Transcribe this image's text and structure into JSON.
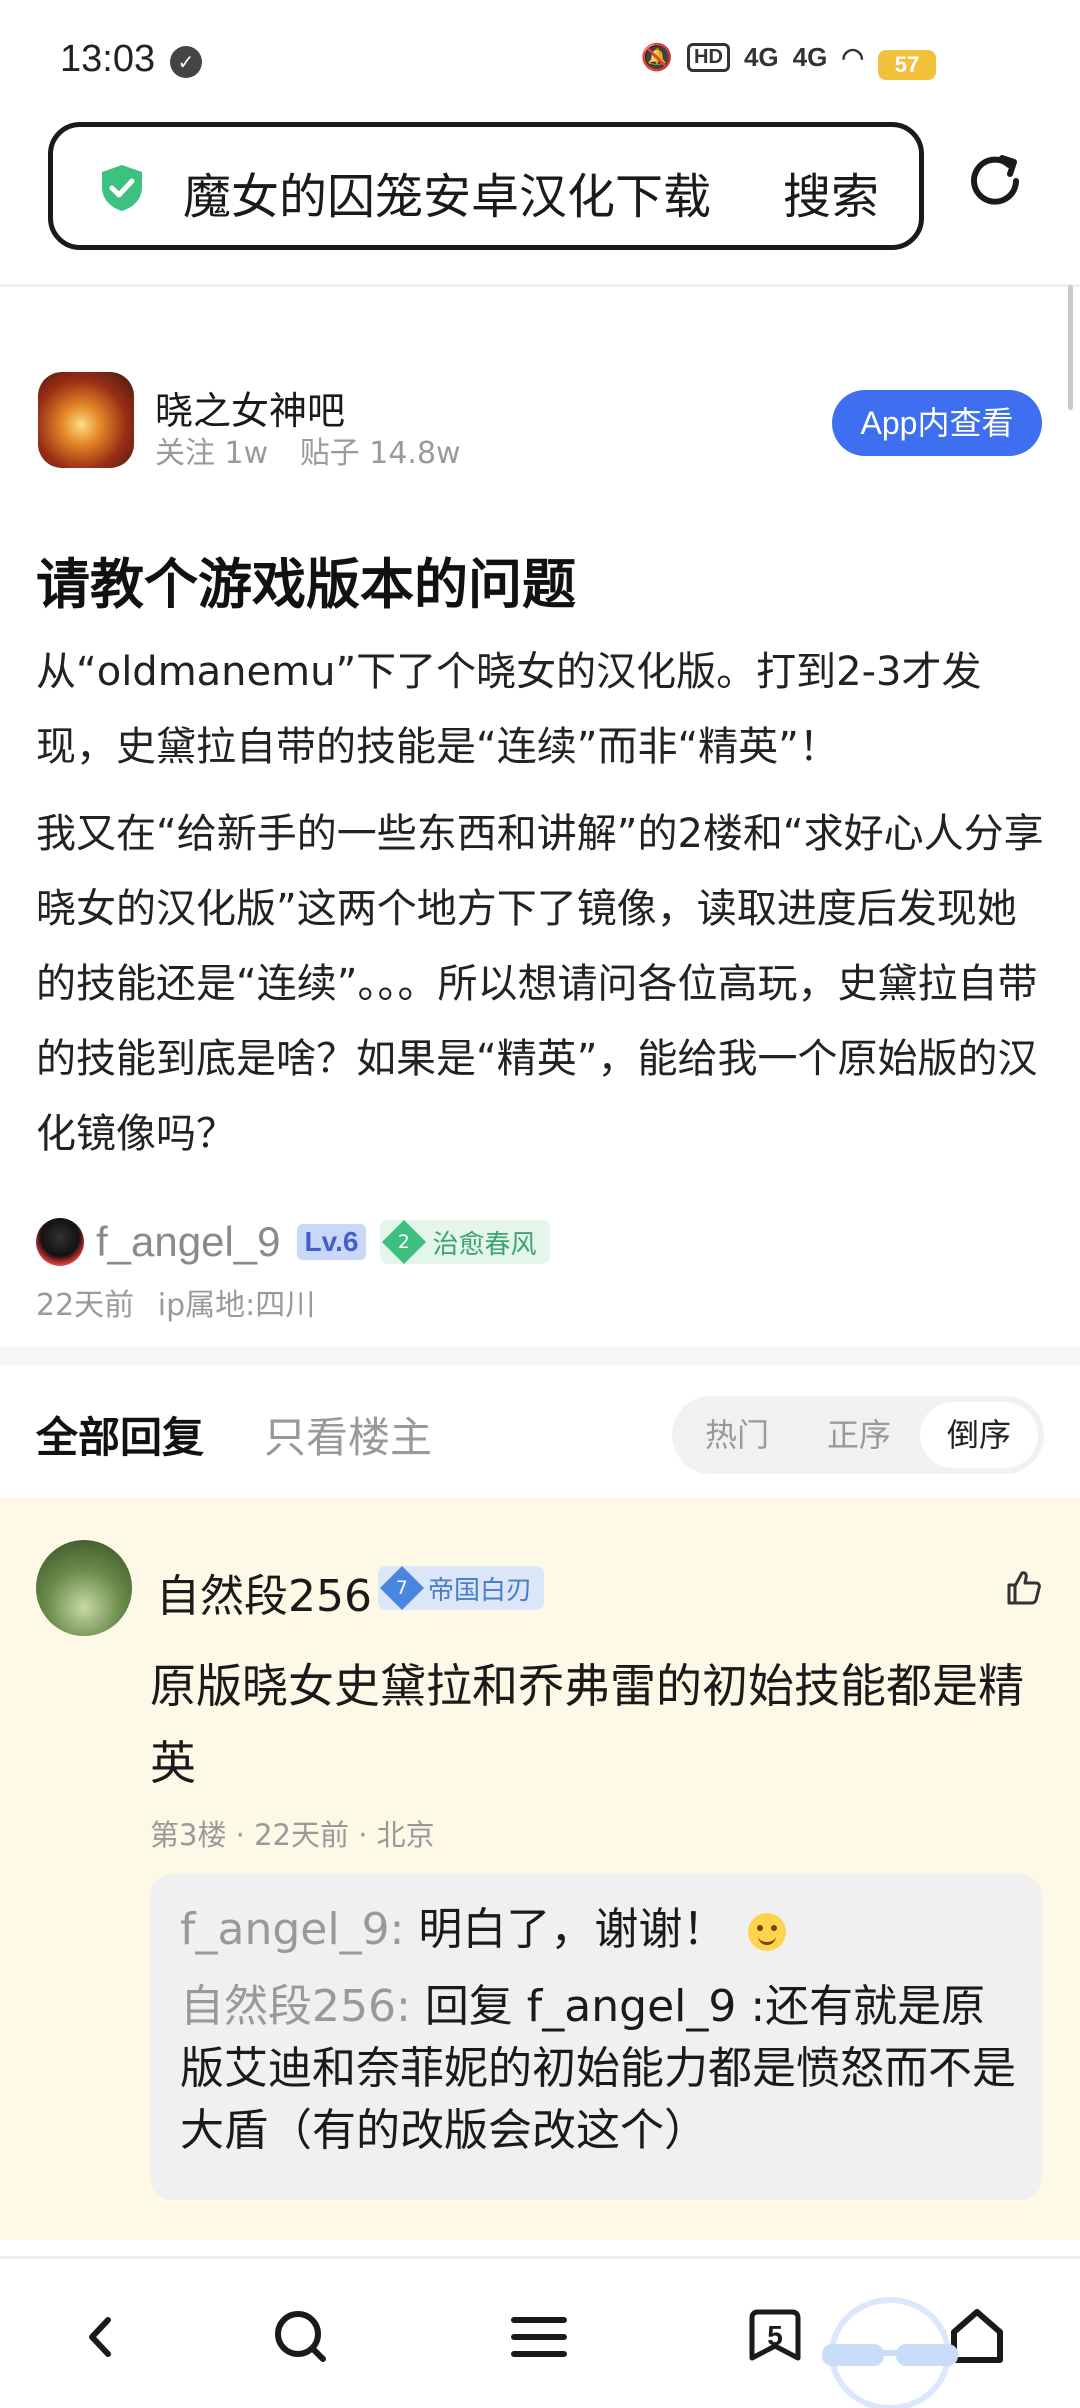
{
  "status_bar": {
    "time": "13:03",
    "hd": "HD",
    "signal1": "4G",
    "signal2": "4G",
    "battery": "57"
  },
  "search": {
    "query": "魔女的囚笼安卓汉化下载",
    "button": "搜索"
  },
  "forum": {
    "name": "晓之女神吧",
    "followers": "关注 1w",
    "posts": "贴子 14.8w",
    "app_button": "App内查看"
  },
  "post": {
    "title": "请教个游戏版本的问题",
    "paragraph1": "从“oldmanemu”下了个晓女的汉化版。打到2-3才发现，史黛拉自带的技能是“连续”而非“精英”！",
    "paragraph2": "我又在“给新手的一些东西和讲解”的2楼和“求好心人分享晓女的汉化版”这两个地方下了镜像，读取进度后发现她的技能还是“连续”。。。所以想请问各位高玩，史黛拉自带的技能到底是啥？如果是“精英”，能给我一个原始版的汉化镜像吗？",
    "author": "f_angel_9",
    "level": "Lv.6",
    "honor_level": "2",
    "honor_title": "治愈春风",
    "time": "22天前",
    "ip": "ip属地:四川"
  },
  "reply_header": {
    "tab_all": "全部回复",
    "tab_op": "只看楼主",
    "sort_hot": "热门",
    "sort_asc": "正序",
    "sort_desc": "倒序"
  },
  "reply": {
    "author": "自然段256",
    "honor_level": "7",
    "honor_title": "帝国白刃",
    "content": "原版晓女史黛拉和乔弗雷的初始技能都是精英",
    "meta": "第3楼 · 22天前 · 北京",
    "sub_replies": [
      {
        "user": "f_angel_9:",
        "text": "明白了，谢谢！",
        "emoji": "smile-emoji-icon"
      },
      {
        "user": "自然段256:",
        "text": "回复 f_angel_9 :还有就是原版艾迪和奈菲妮的初始能力都是愤怒而不是大盾（有的改版会改这个）"
      }
    ]
  },
  "bottom_nav": {
    "tab_count": "5"
  },
  "colors": {
    "accent": "#3e6ff0",
    "reply_bg": "#fdf9e6",
    "shield": "#3cc27e"
  }
}
